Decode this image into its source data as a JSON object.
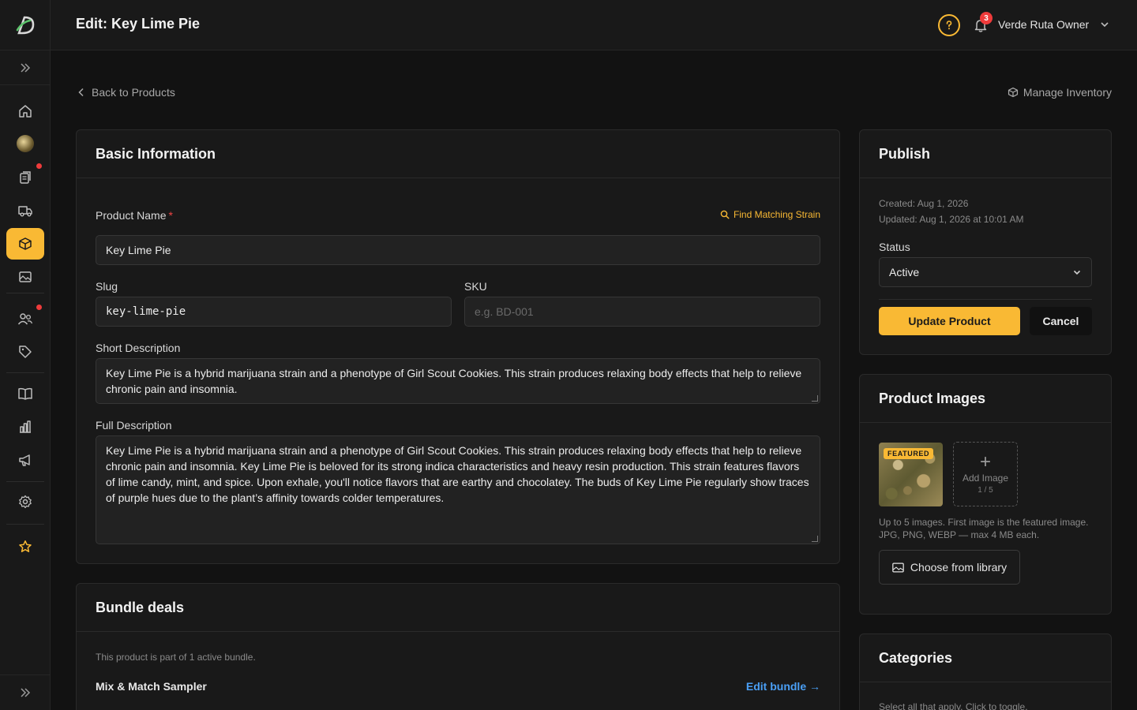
{
  "header": {
    "title": "Edit: Key Lime Pie",
    "notification_count": "3",
    "user_name": "Verde Ruta Owner"
  },
  "subnav": {
    "back_label": "Back to Products",
    "manage_inventory_label": "Manage Inventory"
  },
  "basic_info": {
    "title": "Basic Information",
    "product_name_label": "Product Name",
    "required_mark": "*",
    "find_strain_label": "Find Matching Strain",
    "product_name_value": "Key Lime Pie",
    "slug_label": "Slug",
    "slug_value": "key-lime-pie",
    "sku_label": "SKU",
    "sku_placeholder": "e.g. BD-001",
    "short_desc_label": "Short Description",
    "short_desc_value": "Key Lime Pie is a hybrid marijuana strain and a phenotype of Girl Scout Cookies. This strain produces relaxing body effects that help to relieve chronic pain and insomnia.",
    "full_desc_label": "Full Description",
    "full_desc_value": "Key Lime Pie is a hybrid marijuana strain and a phenotype of Girl Scout Cookies. This strain produces relaxing body effects that help to relieve chronic pain and insomnia. Key Lime Pie is beloved for its strong indica characteristics and heavy resin production. This strain features flavors of lime candy, mint, and spice. Upon exhale, you'll notice flavors that are earthy and chocolatey. The buds of Key Lime Pie regularly show traces of purple hues due to the plant’s affinity towards colder temperatures."
  },
  "bundle": {
    "title": "Bundle deals",
    "note": "This product is part of 1 active bundle.",
    "name": "Mix & Match Sampler",
    "edit_label": "Edit bundle →"
  },
  "publish": {
    "title": "Publish",
    "created": "Created: Aug 1, 2026",
    "updated": "Updated: Aug 1, 2026 at 10:01 AM",
    "status_label": "Status",
    "status_value": "Active",
    "update_label": "Update Product",
    "cancel_label": "Cancel"
  },
  "images": {
    "title": "Product Images",
    "featured_tag": "FEATURED",
    "add_label": "Add Image",
    "count": "1 / 5",
    "help": "Up to 5 images. First image is the featured image. JPG, PNG, WEBP — max 4 MB each.",
    "library_label": "Choose from library"
  },
  "categories": {
    "title": "Categories",
    "note": "Select all that apply. Click to toggle."
  },
  "colors": {
    "accent": "#f9b934",
    "link": "#4a9ff5",
    "badge": "#ef3b3b"
  }
}
